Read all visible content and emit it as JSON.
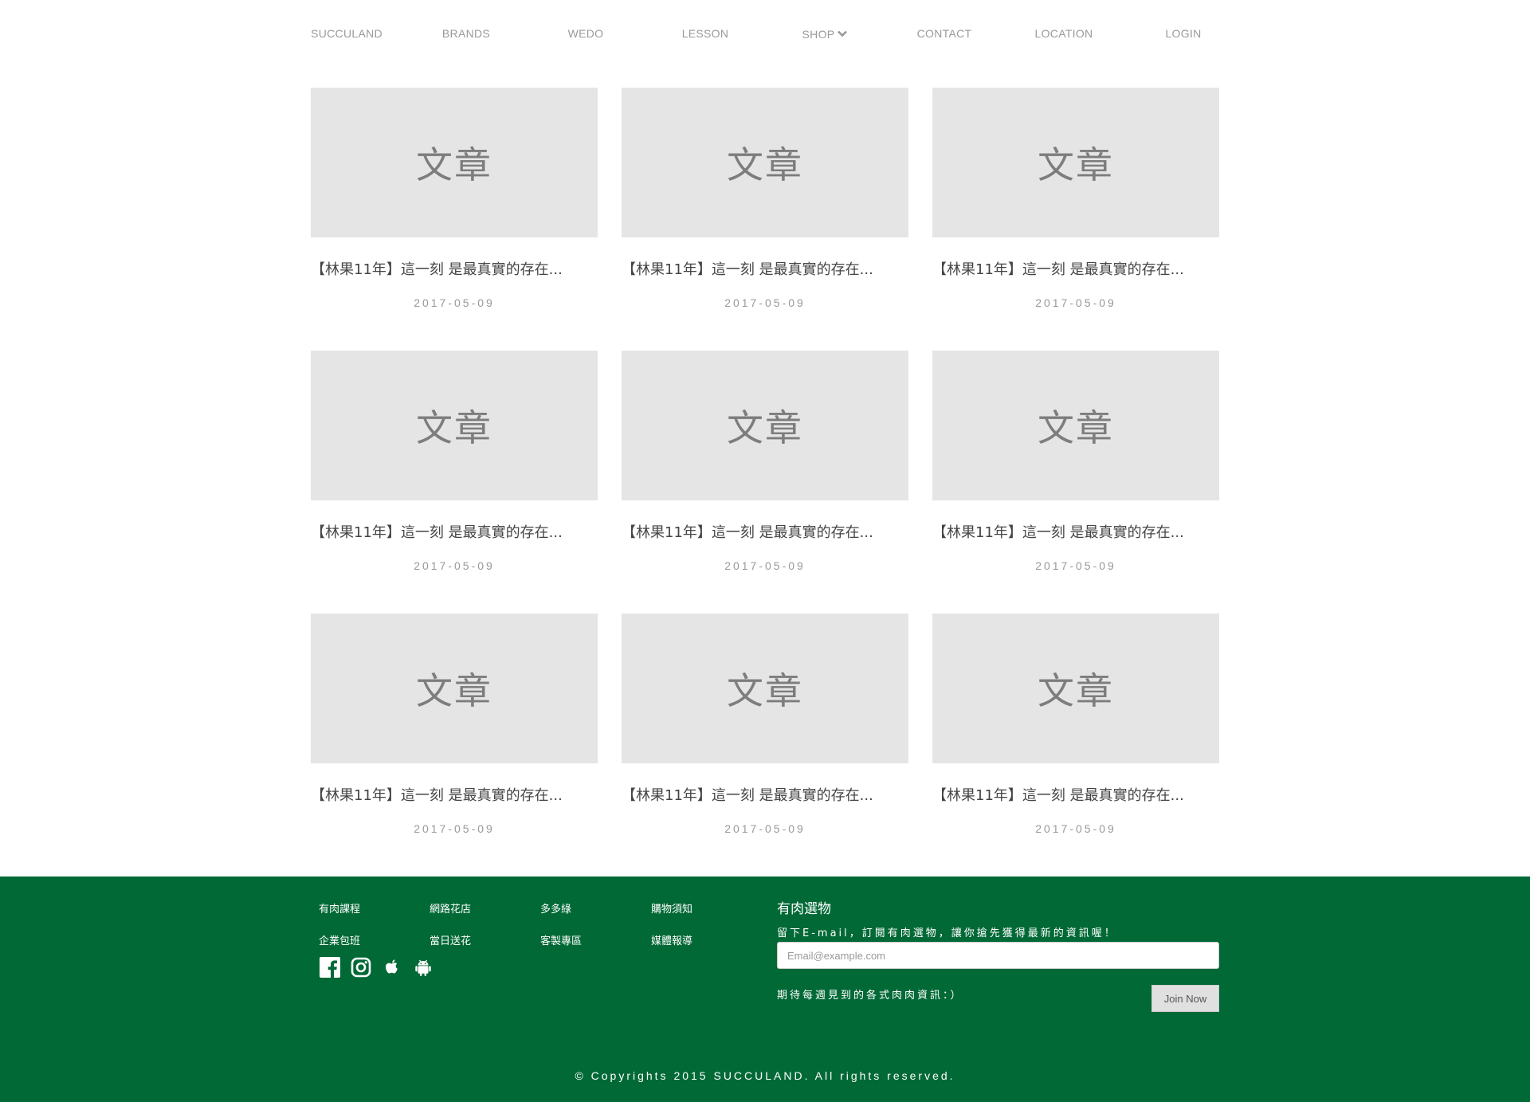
{
  "nav": {
    "items": [
      {
        "label": "SUCCULAND"
      },
      {
        "label": "BRANDS"
      },
      {
        "label": "WEDO"
      },
      {
        "label": "LESSON"
      },
      {
        "label": "SHOP"
      },
      {
        "label": "CONTACT"
      },
      {
        "label": "LOCATION"
      },
      {
        "label": "LOGIN"
      }
    ]
  },
  "articles": [
    {
      "thumb_label": "文章",
      "title": "【林果11年】這一刻 是最真實的存在...",
      "date": "2017-05-09"
    },
    {
      "thumb_label": "文章",
      "title": "【林果11年】這一刻 是最真實的存在...",
      "date": "2017-05-09"
    },
    {
      "thumb_label": "文章",
      "title": "【林果11年】這一刻 是最真實的存在...",
      "date": "2017-05-09"
    },
    {
      "thumb_label": "文章",
      "title": "【林果11年】這一刻 是最真實的存在...",
      "date": "2017-05-09"
    },
    {
      "thumb_label": "文章",
      "title": "【林果11年】這一刻 是最真實的存在...",
      "date": "2017-05-09"
    },
    {
      "thumb_label": "文章",
      "title": "【林果11年】這一刻 是最真實的存在...",
      "date": "2017-05-09"
    },
    {
      "thumb_label": "文章",
      "title": "【林果11年】這一刻 是最真實的存在...",
      "date": "2017-05-09"
    },
    {
      "thumb_label": "文章",
      "title": "【林果11年】這一刻 是最真實的存在...",
      "date": "2017-05-09"
    },
    {
      "thumb_label": "文章",
      "title": "【林果11年】這一刻 是最真實的存在...",
      "date": "2017-05-09"
    }
  ],
  "footer": {
    "background_color": "#016936",
    "links": [
      "有肉課程",
      "網路花店",
      "多多綠",
      "購物須知",
      "企業包班",
      "當日送花",
      "客製專區",
      "媒體報導"
    ],
    "social_icons": [
      "facebook-icon",
      "instagram-icon",
      "apple-icon",
      "android-icon"
    ],
    "newsletter": {
      "title": "有肉選物",
      "description": "留下E-mail，訂閱有肉選物，讓你搶先獲得最新的資訊喔！",
      "email_placeholder": "Email@example.com",
      "note": "期待每週見到的各式肉肉資訊：）",
      "join_label": "Join Now"
    },
    "copyright": "© Copyrights 2015 SUCCULAND. All rights reserved."
  }
}
